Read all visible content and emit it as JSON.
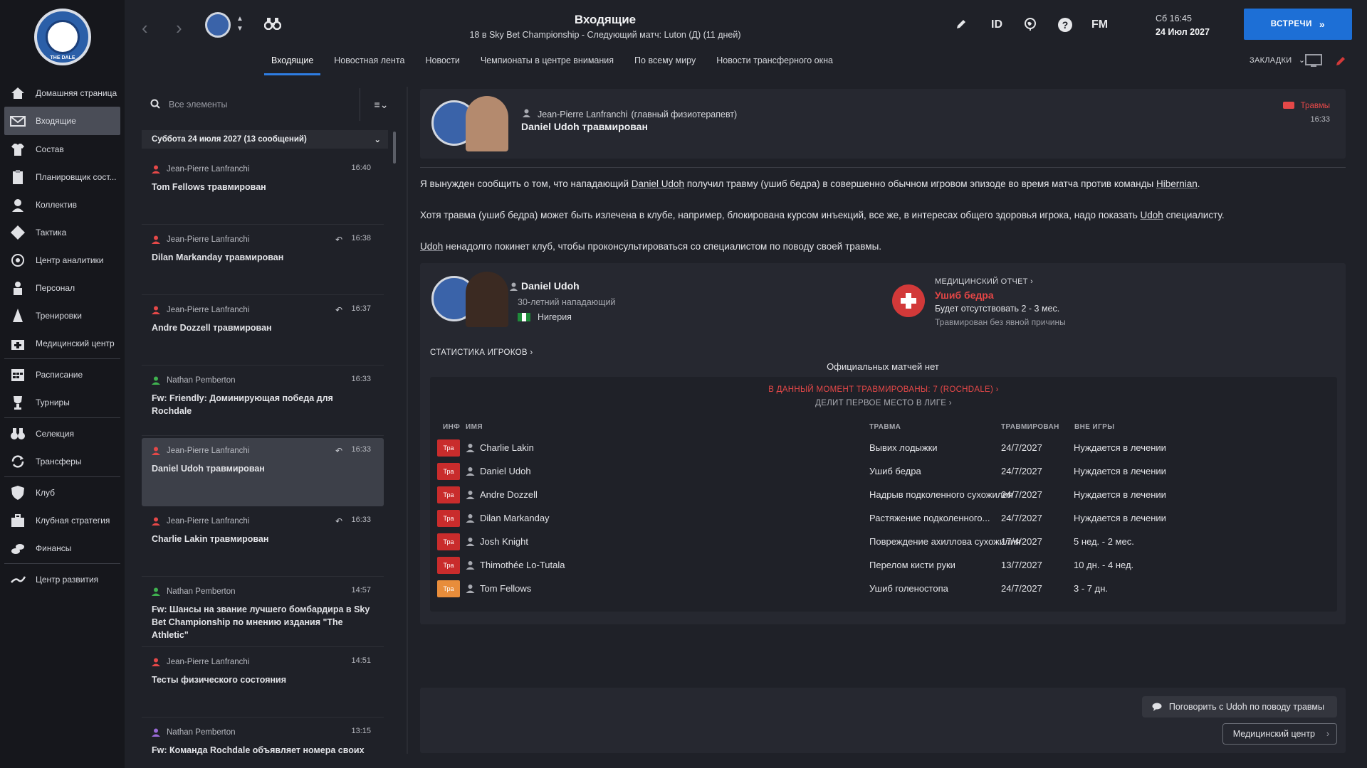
{
  "sidebar": {
    "crest_text": "THE DALE",
    "items": [
      {
        "label": "Домашняя страница",
        "icon": "home-icon"
      },
      {
        "label": "Входящие",
        "icon": "mail-icon",
        "active": true
      },
      {
        "label": "Состав",
        "icon": "shirt-icon"
      },
      {
        "label": "Планировщик сост...",
        "icon": "clipboard-icon"
      },
      {
        "label": "Коллектив",
        "icon": "group-icon"
      },
      {
        "label": "Тактика",
        "icon": "tactics-icon"
      },
      {
        "label": "Центр аналитики",
        "icon": "analytics-icon"
      },
      {
        "label": "Персонал",
        "icon": "staff-icon"
      },
      {
        "label": "Тренировки",
        "icon": "cone-icon"
      },
      {
        "label": "Медицинский центр",
        "icon": "medical-icon"
      },
      {
        "label": "Расписание",
        "icon": "calendar-icon"
      },
      {
        "label": "Турниры",
        "icon": "trophy-icon"
      },
      {
        "label": "Селекция",
        "icon": "binoculars-icon"
      },
      {
        "label": "Трансферы",
        "icon": "transfer-icon"
      },
      {
        "label": "Клуб",
        "icon": "shield-icon"
      },
      {
        "label": "Клубная стратегия",
        "icon": "briefcase-icon"
      },
      {
        "label": "Финансы",
        "icon": "coins-icon"
      },
      {
        "label": "Центр развития",
        "icon": "development-icon"
      }
    ]
  },
  "header": {
    "title": "Входящие",
    "subtitle": "18 в Sky Bet Championship - Следующий матч: Luton (Д) (11 дней)",
    "icons": [
      "pencil-icon",
      "id-icon",
      "globe-icon",
      "help-icon",
      "fm-icon"
    ],
    "id_label": "ID",
    "fm_label": "FM",
    "day_time": "Сб 16:45",
    "date": "24 Июл 2027",
    "meet_button": "ВСТРЕЧИ",
    "bookmarks": "ЗАКЛАДКИ"
  },
  "tabs": [
    {
      "label": "Входящие",
      "active": true
    },
    {
      "label": "Новостная лента"
    },
    {
      "label": "Новости"
    },
    {
      "label": "Чемпионаты в центре внимания"
    },
    {
      "label": "По всему миру"
    },
    {
      "label": "Новости трансферного окна"
    }
  ],
  "inbox": {
    "search_placeholder": "Все элементы",
    "group_label": "Суббота 24 июля 2027 (13 сообщений)",
    "messages": [
      {
        "sender": "Jean-Pierre Lanfranchi",
        "time": "16:40",
        "subject": "Tom Fellows травмирован",
        "reply": false,
        "person": "red"
      },
      {
        "sender": "Jean-Pierre Lanfranchi",
        "time": "16:38",
        "subject": "Dilan Markanday травмирован",
        "reply": true,
        "person": "red"
      },
      {
        "sender": "Jean-Pierre Lanfranchi",
        "time": "16:37",
        "subject": "Andre Dozzell травмирован",
        "reply": true,
        "person": "red"
      },
      {
        "sender": "Nathan Pemberton",
        "time": "16:33",
        "subject": "Fw: Friendly: Доминирующая победа для Rochdale",
        "reply": false,
        "person": "green"
      },
      {
        "sender": "Jean-Pierre Lanfranchi",
        "time": "16:33",
        "subject": "Daniel Udoh травмирован",
        "reply": true,
        "person": "red",
        "selected": true
      },
      {
        "sender": "Jean-Pierre Lanfranchi",
        "time": "16:33",
        "subject": "Charlie Lakin травмирован",
        "reply": true,
        "person": "red"
      },
      {
        "sender": "Nathan Pemberton",
        "time": "14:57",
        "subject": "Fw: Шансы на звание лучшего бомбардира в Sky Bet Championship по мнению издания \"The Athletic\"",
        "reply": false,
        "person": "green"
      },
      {
        "sender": "Jean-Pierre Lanfranchi",
        "time": "14:51",
        "subject": "Тесты физического состояния",
        "reply": false,
        "person": "red"
      },
      {
        "sender": "Nathan Pemberton",
        "time": "13:15",
        "subject": "Fw: Команда Rochdale объявляет номера своих",
        "reply": false,
        "person": "purple"
      }
    ]
  },
  "message": {
    "sender": "Jean-Pierre Lanfranchi",
    "sender_role": "(главный физиотерапевт)",
    "subject": "Daniel Udoh травмирован",
    "tag": "Травмы",
    "time": "16:33",
    "p1": {
      "a": "Я вынужден сообщить о том, что нападающий ",
      "player": "Daniel Udoh",
      "b": " получил травму (ушиб бедра) в совершенно обычном игровом эпизоде во время матча против команды ",
      "club": "Hibernian",
      "c": "."
    },
    "p2": {
      "a": "Хотя травма (ушиб бедра) может быть излечена в клубе, например, блокирована курсом инъекций, все же, в интересах общего здоровья игрока, надо показать ",
      "player": "Udoh",
      "b": " специалисту."
    },
    "p3": {
      "player": "Udoh",
      "a": " ненадолго покинет клуб, чтобы проконсультироваться со специалистом по поводу своей травмы."
    }
  },
  "player": {
    "name": "Daniel Udoh",
    "age": "30-летний нападающий",
    "nation": "Нигерия",
    "medical_report": "МЕДИЦИНСКИЙ ОТЧЕТ",
    "injury": "Ушиб бедра",
    "absence": "Будет отсутствовать 2 - 3 мес.",
    "cause": "Травмирован без явной причины",
    "stats_link": "СТАТИСТИКА ИГРОКОВ",
    "no_matches": "Официальных матчей нет"
  },
  "injuries": {
    "current": "В ДАННЫЙ МОМЕНТ ТРАВМИРОВАНЫ: 7 (ROCHDALE)",
    "league": "ДЕЛИТ ПЕРВОЕ МЕСТО В ЛИГЕ",
    "columns": [
      "ИНФ",
      "ИМЯ",
      "ТРАВМА",
      "ТРАВМИРОВАН",
      "ВНЕ ИГРЫ"
    ],
    "rows": [
      {
        "badge": "Тра",
        "name": "Charlie Lakin",
        "injury": "Вывих лодыжки",
        "date": "24/7/2027",
        "out": "Нуждается в лечении",
        "severity": "major"
      },
      {
        "badge": "Тра",
        "name": "Daniel Udoh",
        "injury": "Ушиб бедра",
        "date": "24/7/2027",
        "out": "Нуждается в лечении",
        "severity": "major"
      },
      {
        "badge": "Тра",
        "name": "Andre Dozzell",
        "injury": "Надрыв подколенного сухожилия",
        "date": "24/7/2027",
        "out": "Нуждается в лечении",
        "severity": "major"
      },
      {
        "badge": "Тра",
        "name": "Dilan Markanday",
        "injury": "Растяжение подколенного...",
        "date": "24/7/2027",
        "out": "Нуждается в лечении",
        "severity": "major"
      },
      {
        "badge": "Тра",
        "name": "Josh Knight",
        "injury": "Повреждение ахиллова сухожилия",
        "date": "17/4/2027",
        "out": "5 нед. - 2 мес.",
        "severity": "major"
      },
      {
        "badge": "Тра",
        "name": "Thimothée Lo-Tutala",
        "injury": "Перелом кисти руки",
        "date": "13/7/2027",
        "out": "10 дн. - 4 нед.",
        "severity": "major"
      },
      {
        "badge": "Тра",
        "name": "Tom Fellows",
        "injury": "Ушиб голеностопа",
        "date": "24/7/2027",
        "out": "3 - 7 дн.",
        "severity": "minor"
      }
    ]
  },
  "actions": {
    "talk": "Поговорить с Udoh по поводу травмы",
    "medical_center": "Медицинский центр"
  },
  "colors": {
    "accent": "#1d6fd6",
    "injury_red": "#e34646",
    "bg": "#1f2128"
  }
}
